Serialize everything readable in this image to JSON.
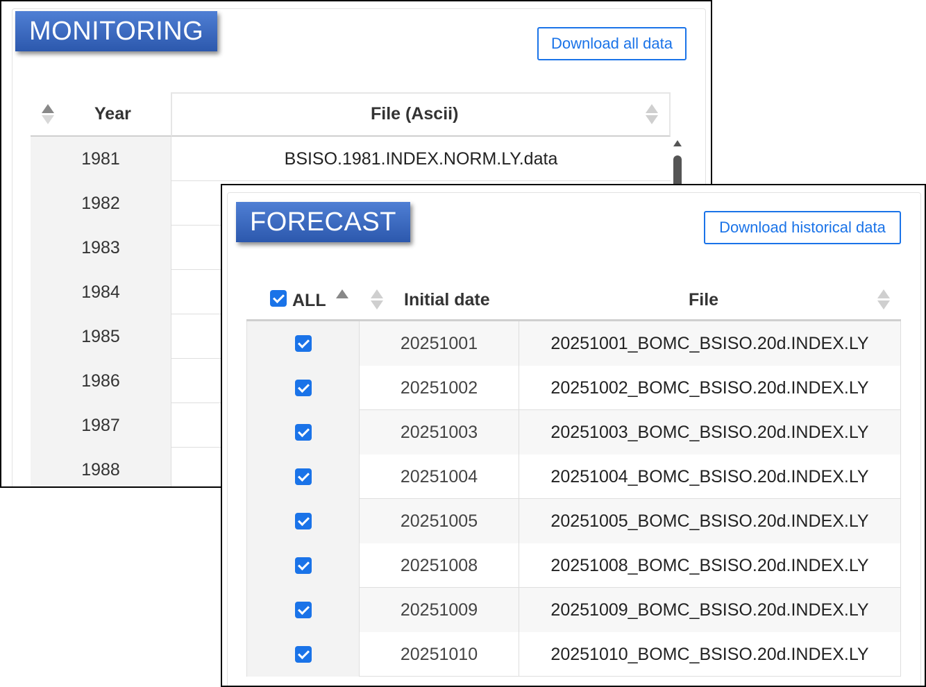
{
  "monitoring": {
    "title": "MONITORING",
    "download_label": "Download all data",
    "columns": {
      "year": "Year",
      "file": "File (Ascii)"
    },
    "rows": [
      {
        "year": "1981",
        "file": "BSISO.1981.INDEX.NORM.LY.data"
      },
      {
        "year": "1982",
        "file": ""
      },
      {
        "year": "1983",
        "file": ""
      },
      {
        "year": "1984",
        "file": ""
      },
      {
        "year": "1985",
        "file": ""
      },
      {
        "year": "1986",
        "file": ""
      },
      {
        "year": "1987",
        "file": ""
      },
      {
        "year": "1988",
        "file": ""
      }
    ]
  },
  "forecast": {
    "title": "FORECAST",
    "download_label": "Download historical data",
    "columns": {
      "all": "ALL",
      "initial_date": "Initial date",
      "file": "File"
    },
    "rows": [
      {
        "date": "20251001",
        "file": "20251001_BOMC_BSISO.20d.INDEX.LY"
      },
      {
        "date": "20251002",
        "file": "20251002_BOMC_BSISO.20d.INDEX.LY"
      },
      {
        "date": "20251003",
        "file": "20251003_BOMC_BSISO.20d.INDEX.LY"
      },
      {
        "date": "20251004",
        "file": "20251004_BOMC_BSISO.20d.INDEX.LY"
      },
      {
        "date": "20251005",
        "file": "20251005_BOMC_BSISO.20d.INDEX.LY"
      },
      {
        "date": "20251008",
        "file": "20251008_BOMC_BSISO.20d.INDEX.LY"
      },
      {
        "date": "20251009",
        "file": "20251009_BOMC_BSISO.20d.INDEX.LY"
      },
      {
        "date": "20251010",
        "file": "20251010_BOMC_BSISO.20d.INDEX.LY"
      }
    ]
  },
  "colors": {
    "accent": "#1a73e8",
    "badge": "#2c58ad"
  },
  "icons": [
    "sort-asc-icon",
    "sort-icon",
    "checkbox-checked-icon",
    "scroll-up-icon"
  ]
}
